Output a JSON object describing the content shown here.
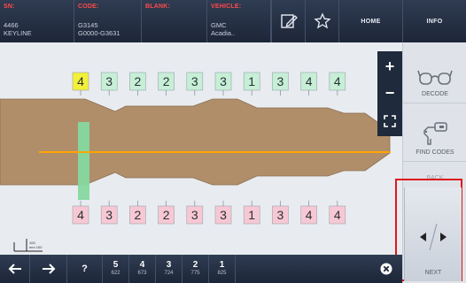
{
  "header": {
    "sn": {
      "label": "SN:",
      "lines": [
        "4466",
        "KEYLINE"
      ]
    },
    "code": {
      "label": "CODE:",
      "lines": [
        "G3145",
        "G0000-G3631"
      ]
    },
    "blank": {
      "label": "BLANK:",
      "lines": [
        "",
        ""
      ]
    },
    "vehicle": {
      "label": "VEHICLE:",
      "lines": [
        "GMC",
        "Acadia.."
      ]
    },
    "home_label": "HOME",
    "info_label": "INFO"
  },
  "key": {
    "top_cuts": [
      "4",
      "3",
      "2",
      "2",
      "3",
      "3",
      "1",
      "3",
      "4",
      "4"
    ],
    "bottom_cuts": [
      "4",
      "3",
      "2",
      "2",
      "3",
      "3",
      "1",
      "3",
      "4",
      "4"
    ],
    "highlighted_cut_index": 0,
    "colors": {
      "blade": "#b08e6a",
      "centerline": "#ffa500",
      "highlight": "#f3f03a",
      "cut_box_top": "#c6efd6",
      "cut_box_bottom": "#f7c8d4",
      "shoulder": "#86d8a0"
    }
  },
  "scale": {
    "lines": [
      "100",
      "mm 100"
    ]
  },
  "sidebar": {
    "decode_label": "DECODE",
    "find_codes_label": "FIND CODES",
    "back_label": "BACK",
    "next_label": "NEXT"
  },
  "bottom": {
    "help": "?",
    "depths": [
      {
        "num": "5",
        "sub": "622"
      },
      {
        "num": "4",
        "sub": "673"
      },
      {
        "num": "3",
        "sub": "724"
      },
      {
        "num": "2",
        "sub": "775"
      },
      {
        "num": "1",
        "sub": "825"
      }
    ]
  }
}
